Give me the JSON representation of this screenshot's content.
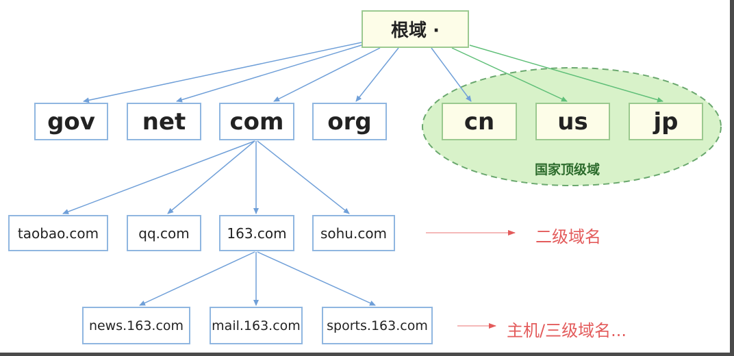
{
  "root": {
    "label": "根域 ·"
  },
  "tlds": [
    "gov",
    "net",
    "com",
    "org"
  ],
  "country_tlds": [
    "cn",
    "us",
    "jp"
  ],
  "country_region_label": "国家顶级域",
  "second_level": [
    "taobao.com",
    "qq.com",
    "163.com",
    "sohu.com"
  ],
  "hosts": [
    "news.163.com",
    "mail.163.com",
    "sports.163.com"
  ],
  "annotations": {
    "second_level": "二级域名",
    "host_level": "主机/三级域名..."
  },
  "colors": {
    "node_border": "#8fb6e0",
    "root_fill": "#fdfde8",
    "edge_blue": "#6f9fd8",
    "edge_green": "#5fbf78",
    "region_fill": "#d8f2c9",
    "region_border": "#6aa86e",
    "annotation_red": "#e35b5b"
  }
}
